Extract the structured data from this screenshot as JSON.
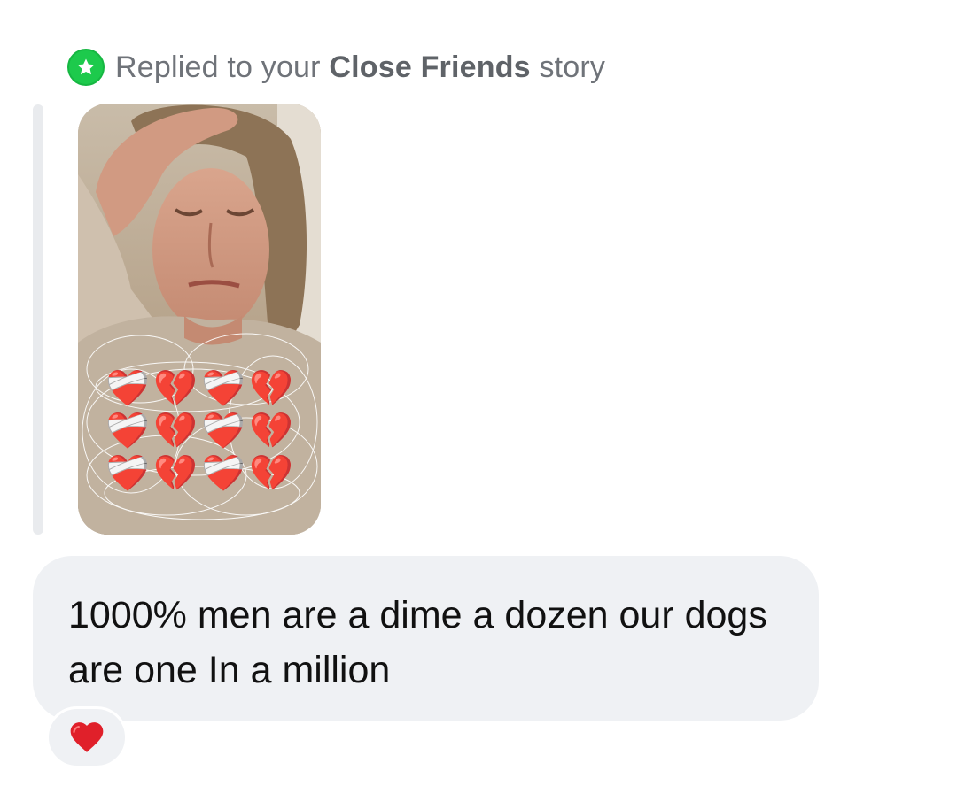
{
  "reply_header": {
    "prefix": "Replied to your",
    "highlight": "Close Friends",
    "suffix": "story",
    "badge_icon": "star-icon",
    "badge_color": "#1dca4c"
  },
  "story": {
    "media": "story-photo",
    "overlay_emoji": {
      "rows": [
        [
          "❤️‍🩹",
          "💔",
          "❤️‍🩹",
          "💔"
        ],
        [
          "❤️‍🩹",
          "💔",
          "❤️‍🩹",
          "💔"
        ],
        [
          "❤️‍🩹",
          "💔",
          "❤️‍🩹",
          "💔"
        ]
      ]
    }
  },
  "message": {
    "text": "1000% men are a dime a dozen our dogs are one In a million"
  },
  "reaction": {
    "emoji": "❤️",
    "icon": "heart-icon",
    "color": "#e0202a"
  }
}
